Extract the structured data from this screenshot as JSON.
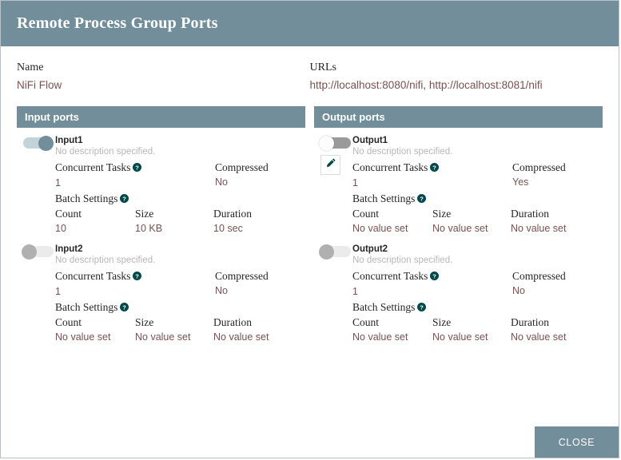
{
  "dialog": {
    "title": "Remote Process Group Ports",
    "close_label": "CLOSE"
  },
  "info": {
    "name_label": "Name",
    "name_value": "NiFi Flow",
    "urls_label": "URLs",
    "urls_value": "http://localhost:8080/nifi, http://localhost:8081/nifi"
  },
  "colors": {
    "header": "#728e9b",
    "value_text": "#775351",
    "help_icon": "#004849",
    "toggle_on": "#728e9b"
  },
  "labels": {
    "concurrent_tasks": "Concurrent Tasks",
    "compressed": "Compressed",
    "batch_settings": "Batch Settings",
    "count": "Count",
    "size": "Size",
    "duration": "Duration",
    "help_icon": "help-icon",
    "edit_icon": "pencil-icon"
  },
  "input_ports": {
    "header": "Input ports",
    "ports": [
      {
        "name": "Input1",
        "description": "No description specified.",
        "enabled": true,
        "toggle_state": "on",
        "editable": false,
        "concurrent_tasks": "1",
        "compressed": "No",
        "count": "10",
        "size": "10 KB",
        "duration": "10 sec"
      },
      {
        "name": "Input2",
        "description": "No description specified.",
        "enabled": false,
        "toggle_state": "disabled",
        "editable": false,
        "concurrent_tasks": "1",
        "compressed": "No",
        "count": "No value set",
        "size": "No value set",
        "duration": "No value set"
      }
    ]
  },
  "output_ports": {
    "header": "Output ports",
    "ports": [
      {
        "name": "Output1",
        "description": "No description specified.",
        "enabled": false,
        "toggle_state": "off",
        "editable": true,
        "concurrent_tasks": "1",
        "compressed": "Yes",
        "count": "No value set",
        "size": "No value set",
        "duration": "No value set"
      },
      {
        "name": "Output2",
        "description": "No description specified.",
        "enabled": false,
        "toggle_state": "disabled",
        "editable": false,
        "concurrent_tasks": "1",
        "compressed": "No",
        "count": "No value set",
        "size": "No value set",
        "duration": "No value set"
      }
    ]
  }
}
